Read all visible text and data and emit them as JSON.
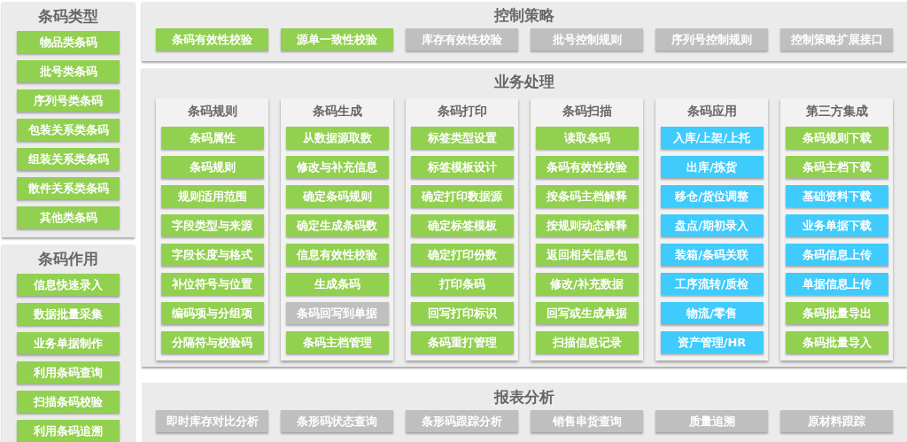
{
  "sidebar": [
    {
      "title": "条码类型",
      "items": [
        {
          "label": "物品类条码",
          "color": "#92d050"
        },
        {
          "label": "批号类条码",
          "color": "#92d050"
        },
        {
          "label": "序列号类条码",
          "color": "#92d050"
        },
        {
          "label": "包装关系类条码",
          "color": "#92d050"
        },
        {
          "label": "组装关系类条码",
          "color": "#92d050"
        },
        {
          "label": "散件关系类条码",
          "color": "#92d050"
        },
        {
          "label": "其他类条码",
          "color": "#92d050"
        }
      ]
    },
    {
      "title": "条码作用",
      "items": [
        {
          "label": "信息快速录入",
          "color": "#92d050"
        },
        {
          "label": "数据批量采集",
          "color": "#92d050"
        },
        {
          "label": "业务单据制作",
          "color": "#92d050"
        },
        {
          "label": "利用条码查询",
          "color": "#92d050"
        },
        {
          "label": "扫描条码校验",
          "color": "#92d050"
        },
        {
          "label": "利用条码追溯",
          "color": "#92d050"
        }
      ]
    }
  ],
  "control_strategy": {
    "title": "控制策略",
    "items": [
      {
        "label": "条码有效性校验",
        "color": "#92d050"
      },
      {
        "label": "源单一致性校验",
        "color": "#92d050"
      },
      {
        "label": "库存有效性校验",
        "color": "#bfbfbf"
      },
      {
        "label": "批号控制规则",
        "color": "#bfbfbf"
      },
      {
        "label": "序列号控制规则",
        "color": "#bfbfbf"
      },
      {
        "label": "控制策略扩展接口",
        "color": "#bfbfbf"
      }
    ]
  },
  "business": {
    "title": "业务处理",
    "columns": [
      {
        "title": "条码规则",
        "items": [
          {
            "label": "条码属性",
            "color": "#92d050"
          },
          {
            "label": "条码规则",
            "color": "#92d050"
          },
          {
            "label": "规则适用范围",
            "color": "#92d050"
          },
          {
            "label": "字段类型与来源",
            "color": "#92d050"
          },
          {
            "label": "字段长度与格式",
            "color": "#92d050"
          },
          {
            "label": "补位符号与位置",
            "color": "#92d050"
          },
          {
            "label": "编码项与分组项",
            "color": "#92d050"
          },
          {
            "label": "分隔符与校验码",
            "color": "#92d050"
          }
        ]
      },
      {
        "title": "条码生成",
        "items": [
          {
            "label": "从数据源取数",
            "color": "#92d050"
          },
          {
            "label": "修改与补充信息",
            "color": "#92d050"
          },
          {
            "label": "确定条码规则",
            "color": "#92d050"
          },
          {
            "label": "确定生成条码数",
            "color": "#92d050"
          },
          {
            "label": "信息有效性校验",
            "color": "#92d050"
          },
          {
            "label": "生成条码",
            "color": "#92d050"
          },
          {
            "label": "条码回写到单据",
            "color": "#bfbfbf"
          },
          {
            "label": "条码主档管理",
            "color": "#92d050"
          }
        ]
      },
      {
        "title": "条码打印",
        "items": [
          {
            "label": "标签类型设置",
            "color": "#92d050"
          },
          {
            "label": "标签模板设计",
            "color": "#92d050"
          },
          {
            "label": "确定打印数据源",
            "color": "#92d050"
          },
          {
            "label": "确定标签模板",
            "color": "#92d050"
          },
          {
            "label": "确定打印份数",
            "color": "#92d050"
          },
          {
            "label": "打印条码",
            "color": "#92d050"
          },
          {
            "label": "回写打印标识",
            "color": "#92d050"
          },
          {
            "label": "条码重打管理",
            "color": "#92d050"
          }
        ]
      },
      {
        "title": "条码扫描",
        "items": [
          {
            "label": "读取条码",
            "color": "#92d050"
          },
          {
            "label": "条码有效性校验",
            "color": "#92d050"
          },
          {
            "label": "按条码主档解释",
            "color": "#92d050"
          },
          {
            "label": "按规则动态解释",
            "color": "#92d050"
          },
          {
            "label": "返回相关信息包",
            "color": "#92d050"
          },
          {
            "label": "修改/补充数据",
            "color": "#92d050"
          },
          {
            "label": "回写或生成单据",
            "color": "#92d050"
          },
          {
            "label": "扫描信息记录",
            "color": "#92d050"
          }
        ]
      },
      {
        "title": "条码应用",
        "items": [
          {
            "label": "入库/上架/上托",
            "color": "#3fcbfc"
          },
          {
            "label": "出库/拣货",
            "color": "#3fcbfc"
          },
          {
            "label": "移仓/货位调整",
            "color": "#3fcbfc"
          },
          {
            "label": "盘点/期初录入",
            "color": "#3fcbfc"
          },
          {
            "label": "装箱/条码关联",
            "color": "#3fcbfc"
          },
          {
            "label": "工序流转/质检",
            "color": "#3fcbfc"
          },
          {
            "label": "物流/零售",
            "color": "#3fcbfc"
          },
          {
            "label": "资产管理/HR",
            "color": "#3fcbfc"
          }
        ]
      },
      {
        "title": "第三方集成",
        "items": [
          {
            "label": "条码规则下载",
            "color": "#92d050"
          },
          {
            "label": "条码主档下载",
            "color": "#92d050"
          },
          {
            "label": "基础资料下载",
            "color": "#3fcbfc"
          },
          {
            "label": "业务单据下载",
            "color": "#3fcbfc"
          },
          {
            "label": "条码信息上传",
            "color": "#3fcbfc"
          },
          {
            "label": "单据信息上传",
            "color": "#3fcbfc"
          },
          {
            "label": "条码批量导出",
            "color": "#92d050"
          },
          {
            "label": "条码批量导入",
            "color": "#92d050"
          }
        ]
      }
    ]
  },
  "reports": {
    "title": "报表分析",
    "items": [
      {
        "label": "即时库存对比分析",
        "color": "#bfbfbf"
      },
      {
        "label": "条形码状态查询",
        "color": "#bfbfbf"
      },
      {
        "label": "条形码跟踪分析",
        "color": "#bfbfbf"
      },
      {
        "label": "销售串货查询",
        "color": "#bfbfbf"
      },
      {
        "label": "质量追溯",
        "color": "#bfbfbf"
      },
      {
        "label": "原材料跟踪",
        "color": "#bfbfbf"
      }
    ]
  }
}
